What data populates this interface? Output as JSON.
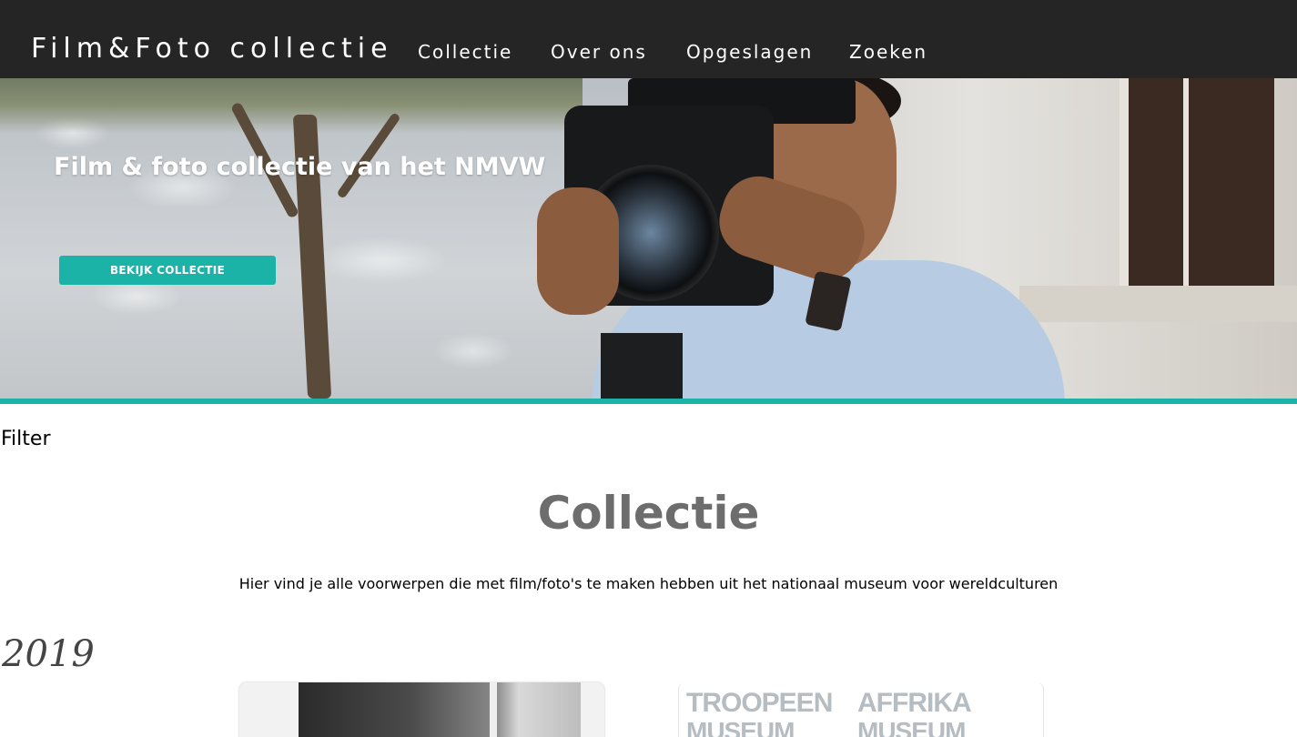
{
  "nav": {
    "brand": "Film&Foto collectie",
    "links": [
      "Collectie",
      "Over ons",
      "Opgeslagen",
      "Zoeken"
    ]
  },
  "hero": {
    "title": "Film & foto collectie van het NMVW",
    "button_label": "BEKIJK COLLECTIE",
    "image_description_icon": "cameraman-photo"
  },
  "filter_label": "Filter",
  "main": {
    "title": "Collectie",
    "intro": "Hier vind je alle voorwerpen die met film/foto's te maken hebben uit het nationaal museum voor wereldculturen",
    "year": "2019"
  },
  "cards": [
    {
      "image": "black-and-white-photo"
    },
    {
      "image": "museum-logos",
      "logo_1": "TROOPEEN",
      "logo_1_sub": "MUSEUM",
      "logo_2": "AFFRIKA",
      "logo_2_sub": "MUSEUM"
    }
  ],
  "colors": {
    "nav_bg": "#252525",
    "accent": "#1bb3a8",
    "title_gray": "#6d6d6d"
  }
}
